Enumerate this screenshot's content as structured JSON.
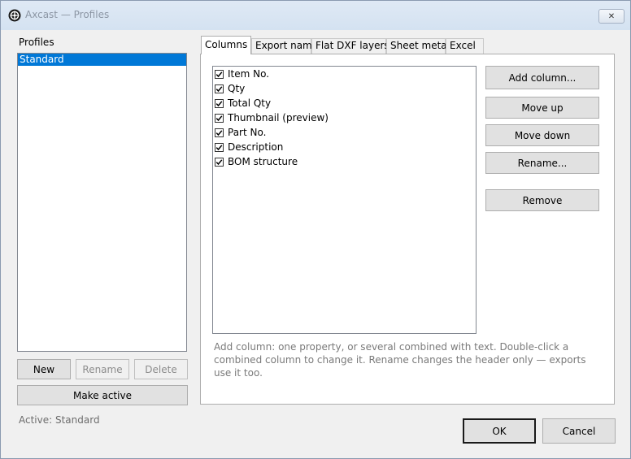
{
  "window": {
    "title": "Axcast — Profiles",
    "close_glyph": "✕",
    "icon": "app-logo-icon"
  },
  "profiles": {
    "heading": "Profiles",
    "items": [
      {
        "label": "Standard",
        "selected": true
      }
    ],
    "buttons": {
      "new": "New",
      "rename": "Rename",
      "delete": "Delete",
      "make_active": "Make active"
    },
    "active_status": "Active: Standard"
  },
  "tabs": [
    {
      "label": "Columns",
      "active": true
    },
    {
      "label": "Export name",
      "active": false
    },
    {
      "label": "Flat DXF layers",
      "active": false
    },
    {
      "label": "Sheet metal",
      "active": false
    },
    {
      "label": "Excel",
      "active": false
    }
  ],
  "columns": {
    "items": [
      {
        "label": "Item No.",
        "checked": true
      },
      {
        "label": "Qty",
        "checked": true
      },
      {
        "label": "Total Qty",
        "checked": true
      },
      {
        "label": "Thumbnail (preview)",
        "checked": true
      },
      {
        "label": "Part No.",
        "checked": true
      },
      {
        "label": "Description",
        "checked": true
      },
      {
        "label": "BOM structure",
        "checked": true
      }
    ],
    "buttons": {
      "add_column": "Add column...",
      "move_up": "Move up",
      "move_down": "Move down",
      "rename": "Rename...",
      "remove": "Remove"
    },
    "hint": "Add column: one property, or several combined with text. Double-click a combined column to change it. Rename changes the header only — exports use it too."
  },
  "dialog_buttons": {
    "ok": "OK",
    "cancel": "Cancel"
  },
  "colors": {
    "selection": "#0078d7",
    "title_text": "#8c96a4",
    "hint_text": "#7a7a7a"
  }
}
